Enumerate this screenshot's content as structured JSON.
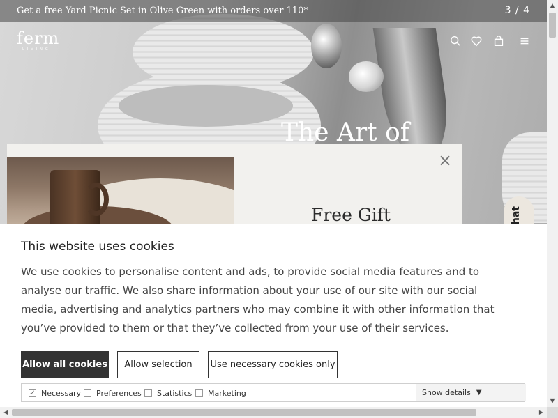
{
  "announcement": {
    "text": "Get a free Yard Picnic Set in Olive Green with orders over 110*",
    "counter": "3 / 4"
  },
  "header": {
    "logo_main": "ferm",
    "logo_sub": "LIVING",
    "icons": [
      "search-icon",
      "heart-icon",
      "bag-icon",
      "menu-icon"
    ]
  },
  "hero": {
    "heading": "The Art of"
  },
  "gift_popup": {
    "title": "Free Gift",
    "close_label": "×"
  },
  "chat": {
    "label": "Chat"
  },
  "cookie_banner": {
    "title": "This website uses cookies",
    "body": "We use cookies to personalise content and ads, to provide social media features and to analyse our traffic. We also share information about your use of our site with our social media, advertising and analytics partners who may combine it with other information that you’ve provided to them or that they’ve collected from your use of their services.",
    "buttons": {
      "allow_all": "Allow all cookies",
      "allow_selection": "Allow selection",
      "necessary_only": "Use necessary cookies only"
    },
    "preferences": [
      {
        "label": "Necessary",
        "checked": true
      },
      {
        "label": "Preferences",
        "checked": false
      },
      {
        "label": "Statistics",
        "checked": false
      },
      {
        "label": "Marketing",
        "checked": false
      }
    ],
    "show_details": "Show details"
  },
  "colors": {
    "primary_button": "#333333",
    "banner_bg": "#ffffff",
    "popup_bg": "#f2f1ee"
  }
}
